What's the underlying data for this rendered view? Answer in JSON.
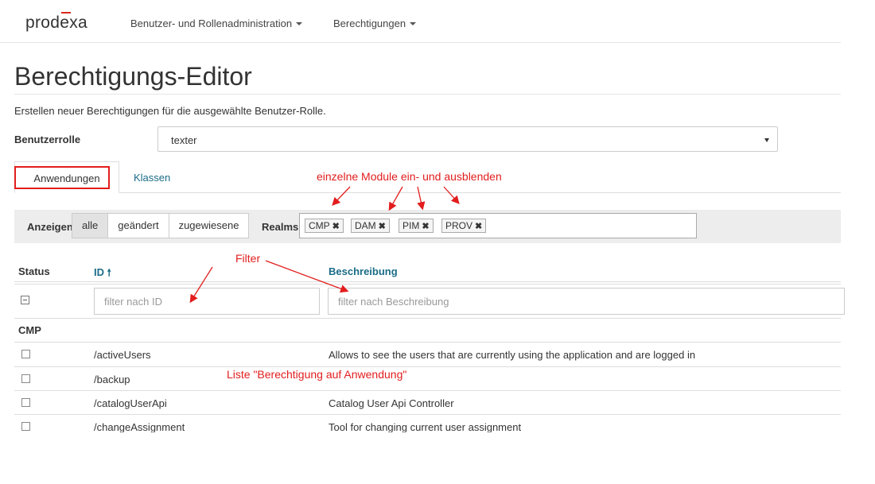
{
  "header": {
    "brand": "prodexa",
    "menu": [
      {
        "label": "Benutzer- und Rollenadministration"
      },
      {
        "label": "Berechtigungen"
      }
    ]
  },
  "page": {
    "title": "Berechtigungs-Editor",
    "subtitle": "Erstellen neuer Berechtigungen für die ausgewählte Benutzer-Rolle."
  },
  "role": {
    "label": "Benutzerrolle",
    "value": "texter"
  },
  "tabs": [
    {
      "label": "Anwendungen",
      "active": true
    },
    {
      "label": "Klassen",
      "active": false
    }
  ],
  "filterbar": {
    "show_label": "Anzeigen",
    "buttons": [
      {
        "label": "alle",
        "active": true
      },
      {
        "label": "geändert",
        "active": false
      },
      {
        "label": "zugewiesene",
        "active": false
      }
    ],
    "realms_label": "Realms",
    "realms": [
      "CMP",
      "DAM",
      "PIM",
      "PROV"
    ]
  },
  "table": {
    "headers": {
      "status": "Status",
      "id": "ID",
      "description": "Beschreibung"
    },
    "filter_id_placeholder": "filter nach ID",
    "filter_desc_placeholder": "filter nach Beschreibung",
    "group": "CMP",
    "rows": [
      {
        "id": "/activeUsers",
        "description": "Allows to see the users that are currently using the application and are logged in"
      },
      {
        "id": "/backup",
        "description": ""
      },
      {
        "id": "/catalogUserApi",
        "description": "Catalog User Api Controller"
      },
      {
        "id": "/changeAssignment",
        "description": "Tool for changing current user assignment"
      }
    ]
  },
  "annotations": {
    "modules": "einzelne Module ein- und ausblenden",
    "filter": "Filter",
    "list": "Liste \"Berechtigung auf Anwendung\""
  },
  "colors": {
    "accent": "#1b6c87",
    "annotation": "#e21d1d"
  }
}
